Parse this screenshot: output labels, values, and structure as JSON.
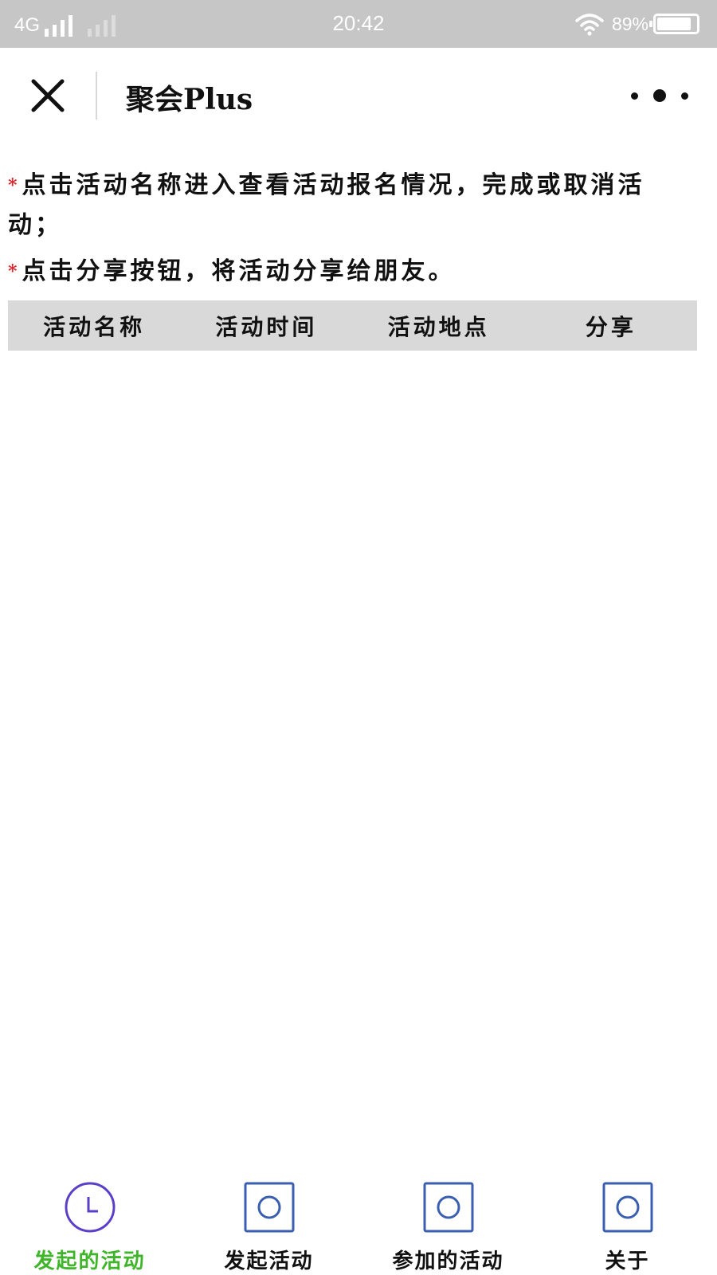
{
  "status_bar": {
    "network": "4G",
    "time": "20:42",
    "battery_percent": "89%",
    "battery_level": 0.89
  },
  "title_bar": {
    "title": "聚会Plus"
  },
  "notes": [
    {
      "marker": "*",
      "text": "点击活动名称进入查看活动报名情况，完成或取消活动；"
    },
    {
      "marker": "*",
      "text": "点击分享按钮，将活动分享给朋友。"
    }
  ],
  "table": {
    "headers": [
      "活动名称",
      "活动时间",
      "活动地点",
      "分享"
    ]
  },
  "tab_bar": {
    "items": [
      {
        "label": "发起的活动",
        "icon": "clock-icon",
        "active": true
      },
      {
        "label": "发起活动",
        "icon": "square-circle-icon",
        "active": false
      },
      {
        "label": "参加的活动",
        "icon": "square-circle-icon",
        "active": false
      },
      {
        "label": "关于",
        "icon": "square-circle-icon",
        "active": false
      }
    ],
    "active_color": "#3fb52a",
    "icon_color": "#3b5fb0",
    "clock_color": "#5b3fc8"
  }
}
